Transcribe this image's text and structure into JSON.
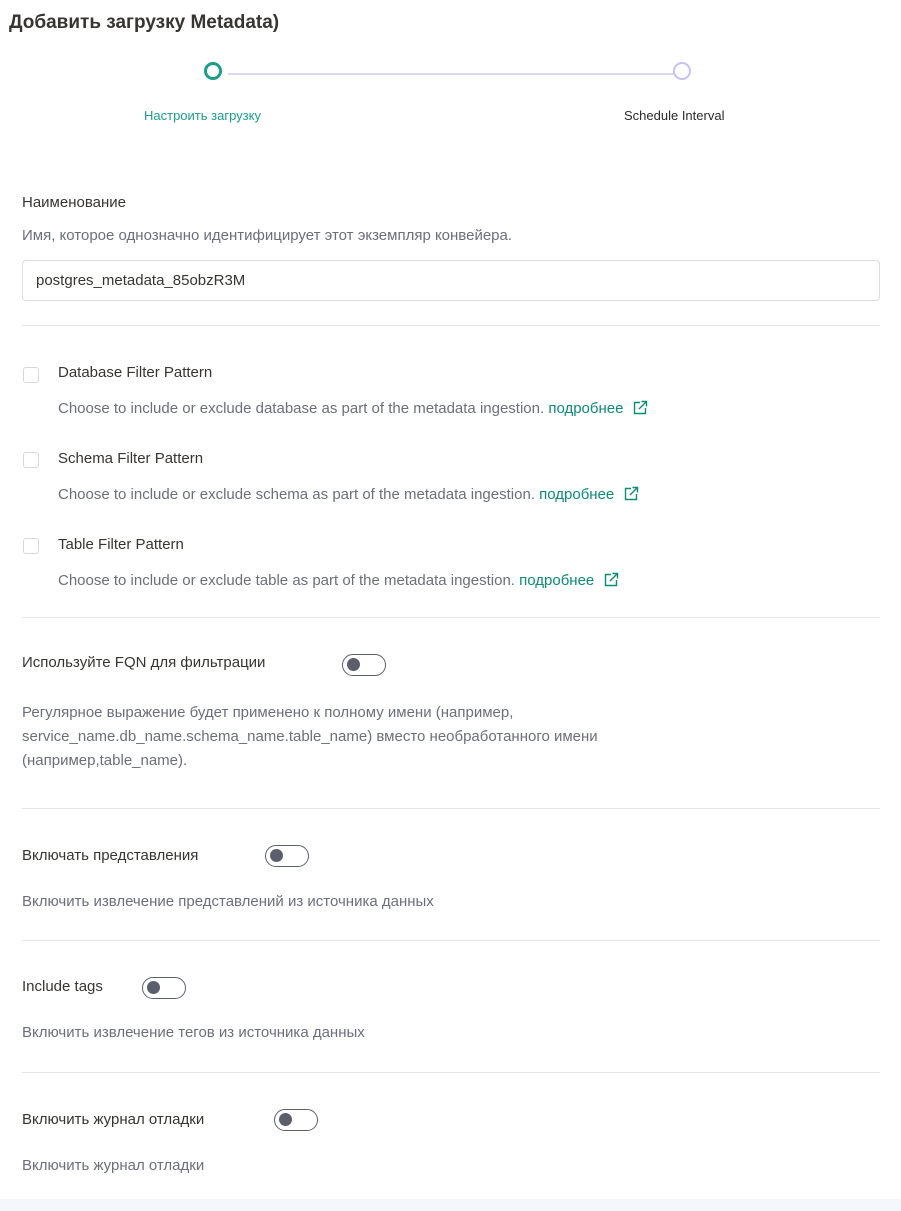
{
  "title": "Добавить загрузку Metadata)",
  "stepper": {
    "steps": [
      {
        "label": "Настроить загрузку",
        "state": "active"
      },
      {
        "label": "Schedule Interval",
        "state": "pending"
      }
    ]
  },
  "name_field": {
    "label": "Наименование",
    "description": "Имя, которое однозначно идентифицирует этот экземпляр конвейера.",
    "value": "postgres_metadata_85obzR3M"
  },
  "filters": [
    {
      "label": "Database Filter Pattern",
      "description": "Choose to include or exclude database as part of the metadata ingestion.",
      "link": "подробнее",
      "checked": false
    },
    {
      "label": "Schema Filter Pattern",
      "description": "Choose to include or exclude schema as part of the metadata ingestion.",
      "link": "подробнее",
      "checked": false
    },
    {
      "label": "Table Filter Pattern",
      "description": "Choose to include or exclude table as part of the metadata ingestion.",
      "link": "подробнее",
      "checked": false
    }
  ],
  "toggles": [
    {
      "label": "Используйте FQN для фильтрации",
      "description_lines": [
        "Регулярное выражение будет применено к полному имени (например,",
        "service_name.db_name.schema_name.table_name) вместо необработанного имени",
        "(например,table_name)."
      ],
      "enabled": false
    },
    {
      "label": "Включать представления",
      "description_lines": [
        "Включить извлечение представлений из источника данных"
      ],
      "enabled": false
    },
    {
      "label": "Include tags",
      "description_lines": [
        "Включить извлечение тегов из источника данных"
      ],
      "enabled": false
    },
    {
      "label": "Включить журнал отладки",
      "description_lines": [
        "Включить журнал отладки"
      ],
      "enabled": false
    }
  ],
  "colors": {
    "accent": "#1a9e8a",
    "link": "#0b8b78",
    "pending_step": "#c9c0ef",
    "muted_text": "#6b6f7b"
  }
}
